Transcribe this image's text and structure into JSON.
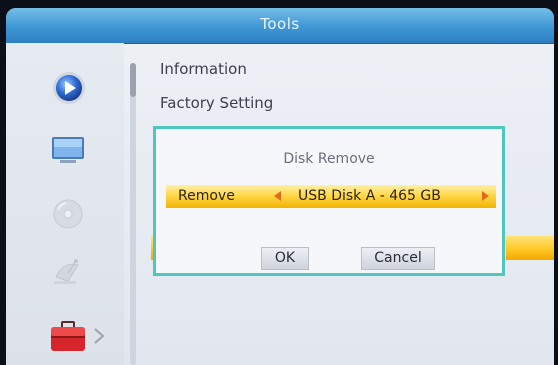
{
  "header": {
    "title": "Tools"
  },
  "sidebar": {
    "icons": [
      "play-icon",
      "tv-screen-icon",
      "disc-icon",
      "satellite-dish-icon",
      "toolbox-icon"
    ]
  },
  "menu": {
    "items": [
      "Information",
      "Factory Setting"
    ]
  },
  "dialog": {
    "title": "Disk Remove",
    "remove_label": "Remove",
    "remove_value": "USB Disk A - 465 GB",
    "ok_label": "OK",
    "cancel_label": "Cancel"
  },
  "colors": {
    "title_bar": "#3f97d5",
    "highlight": "#ffc826",
    "dialog_border": "#4fc7bf",
    "arrow": "#e36a1c"
  }
}
